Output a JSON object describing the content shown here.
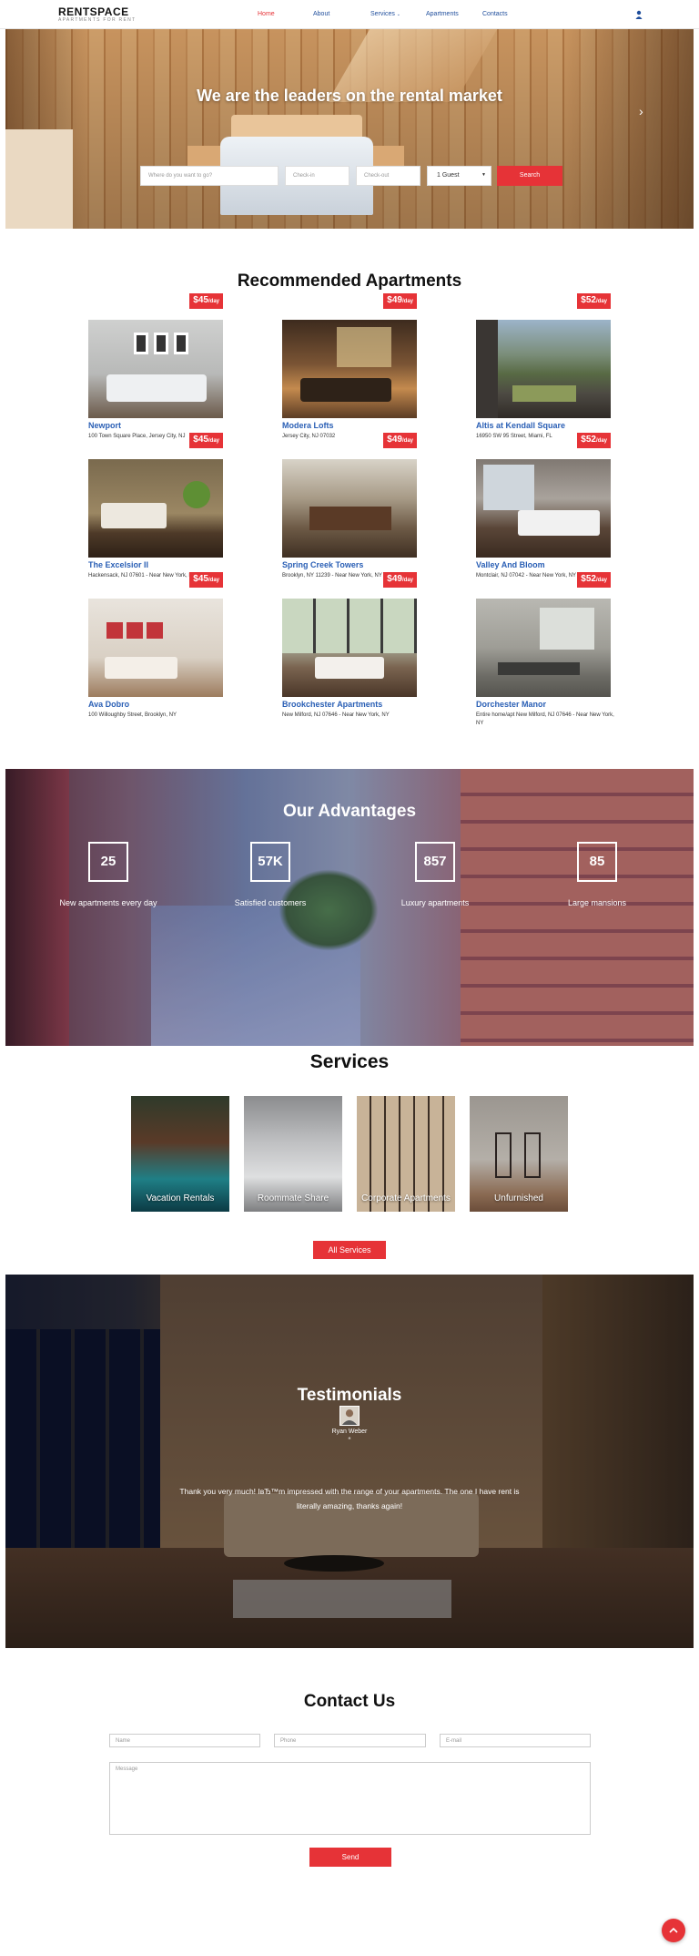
{
  "header": {
    "logo_main": "RENTSPACE",
    "logo_sub": "APARTMENTS FOR RENT",
    "nav": [
      {
        "label": "Home",
        "active": true
      },
      {
        "label": "About"
      },
      {
        "label": "Services"
      },
      {
        "label": "Apartments"
      },
      {
        "label": "Contacts"
      }
    ],
    "user_icon": "user-icon"
  },
  "hero": {
    "title": "We are the leaders on the rental market",
    "next_icon": "chevron-right-icon",
    "search": {
      "where_placeholder": "Where do you want to go?",
      "checkin_placeholder": "Check-in",
      "checkout_placeholder": "Check-out",
      "guests_value": "1 Guest",
      "button": "Search"
    }
  },
  "recommended": {
    "title": "Recommended Apartments",
    "items": [
      {
        "name": "Newport",
        "address": "100 Town Square Place, Jersey City, NJ",
        "price": "$45",
        "unit": "/day"
      },
      {
        "name": "Modera Lofts",
        "address": "Jersey City, NJ 07032",
        "price": "$49",
        "unit": "/day"
      },
      {
        "name": "Altis at Kendall Square",
        "address": "16950 SW 95 Street, Miami, FL",
        "price": "$52",
        "unit": "/day"
      },
      {
        "name": "The Excelsior II",
        "address": "Hackensack, NJ 07601 - Near New York, NY",
        "price": "$45",
        "unit": "/day"
      },
      {
        "name": "Spring Creek Towers",
        "address": "Brooklyn, NY 11239 - Near New York, NY",
        "price": "$49",
        "unit": "/day"
      },
      {
        "name": "Valley And Bloom",
        "address": "Montclair, NJ 07042 - Near New York, NY",
        "price": "$52",
        "unit": "/day"
      },
      {
        "name": "Ava Dobro",
        "address": "100 Willoughby Street, Brooklyn, NY",
        "price": "$45",
        "unit": "/day"
      },
      {
        "name": "Brookchester Apartments",
        "address": "New Milford, NJ 07646 - Near New York, NY",
        "price": "$49",
        "unit": "/day"
      },
      {
        "name": "Dorchester Manor",
        "address": "Entire home/apt New Milford, NJ 07646 - Near New York, NY",
        "price": "$52",
        "unit": "/day"
      }
    ]
  },
  "advantages": {
    "title": "Our Advantages",
    "stats": [
      {
        "value": "25",
        "label": "New apartments every day"
      },
      {
        "value": "57K",
        "label": "Satisfied customers"
      },
      {
        "value": "857",
        "label": "Luxury apartments"
      },
      {
        "value": "85",
        "label": "Large mansions"
      }
    ]
  },
  "services": {
    "title": "Services",
    "items": [
      "Vacation Rentals",
      "Roommate Share",
      "Corporate Apartments",
      "Unfurnished"
    ],
    "button": "All Services"
  },
  "testimonials": {
    "title": "Testimonials",
    "name": "Ryan Weber",
    "quote_mark": "“",
    "text": "Thank you very much! IвЂ™m impressed with the range of your apartments. The one I have rent is literally amazing, thanks again!"
  },
  "contact": {
    "title": "Contact Us",
    "name_placeholder": "Name",
    "phone_placeholder": "Phone",
    "email_placeholder": "E-mail",
    "message_placeholder": "Message",
    "button": "Send"
  },
  "colors": {
    "accent": "#e63337",
    "link": "#2a5fb5"
  }
}
